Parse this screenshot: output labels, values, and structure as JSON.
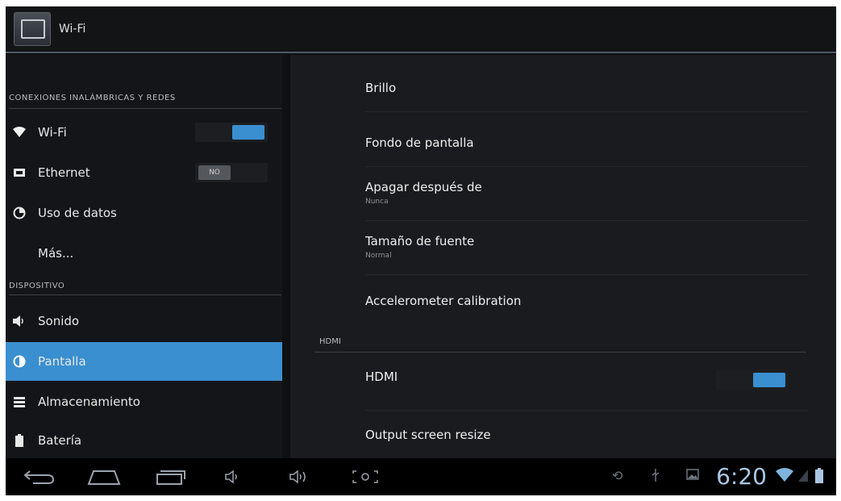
{
  "action_bar": {
    "title": "Wi-Fi",
    "icon": "settings-app-icon"
  },
  "left_list": {
    "section_wireless": "CONEXIONES INALÁMBRICAS Y REDES",
    "section_device": "DISPOSITIVO",
    "items": [
      {
        "label": "Wi-Fi",
        "icon": "wifi-icon",
        "switch": "on"
      },
      {
        "label": "Ethernet",
        "icon": "ethernet-icon",
        "switch": "off",
        "switch_text": "NO"
      },
      {
        "label": "Uso de datos",
        "icon": "data-usage-icon"
      },
      {
        "label": "Más..."
      },
      {
        "label": "Sonido",
        "icon": "speaker-icon"
      },
      {
        "label": "Pantalla",
        "icon": "display-icon",
        "selected": true
      },
      {
        "label": "Almacenamiento",
        "icon": "storage-icon"
      },
      {
        "label": "Batería",
        "icon": "battery-icon"
      }
    ]
  },
  "right_panel": {
    "items": [
      {
        "title": "Brillo"
      },
      {
        "title": "Fondo de pantalla"
      },
      {
        "title": "Apagar después de",
        "subtitle": "Nunca"
      },
      {
        "title": "Tamaño de fuente",
        "subtitle": "Normal"
      },
      {
        "title": "Accelerometer calibration"
      }
    ],
    "section_output": "HDMI",
    "output_items": [
      {
        "title": "HDMI",
        "switch": "on"
      },
      {
        "title": "Output screen resize"
      }
    ]
  },
  "system_bar": {
    "clock": "6:20",
    "nav": [
      "back-icon",
      "home-icon",
      "recent-apps-icon",
      "volume-down-icon",
      "volume-up-icon",
      "screenshot-icon"
    ],
    "status": [
      "sync-icon",
      "usb-icon",
      "gallery-icon",
      "wifi-signal-icon",
      "battery-icon"
    ]
  },
  "colors": {
    "accent": "#3a8fd0",
    "background": "#0f1012",
    "panel": "#1a1b1e"
  }
}
